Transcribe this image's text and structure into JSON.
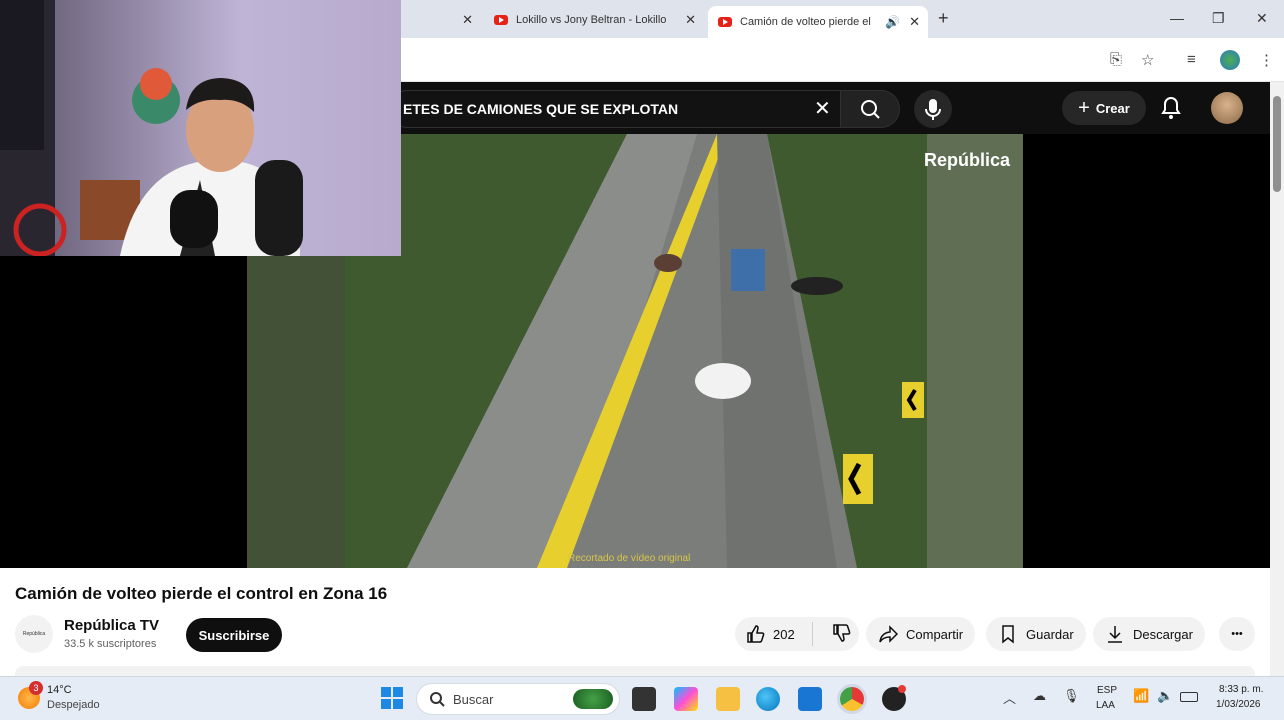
{
  "browser": {
    "tabs": [
      {
        "title": "",
        "active": false
      },
      {
        "title": "Lokillo vs Jony Beltran - Lokillo",
        "active": false
      },
      {
        "title": "Camión de volteo pierde el",
        "active": true
      }
    ],
    "new_tab_label": "+",
    "window": {
      "minimize": "—",
      "maximize": "❐",
      "close": "✕"
    }
  },
  "youtube": {
    "search_query": "ETES DE CAMIONES QUE SE EXPLOTAN",
    "create_label": "Crear",
    "video": {
      "watermark": "República",
      "crop_label": "Recortado de vídeo original",
      "title": "Camión de volteo pierde el control en Zona 16"
    },
    "channel": {
      "logo_text": "República",
      "name": "República TV",
      "subscribers": "33.5 k suscriptores",
      "subscribe_label": "Suscribirse"
    },
    "actions": {
      "likes": "202",
      "share_label": "Compartir",
      "save_label": "Guardar",
      "download_label": "Descargar",
      "more_label": "•••"
    }
  },
  "taskbar": {
    "weather": {
      "badge": "3",
      "temp": "14°C",
      "condition": "Despejado"
    },
    "search_label": "Buscar",
    "lang": {
      "line1": "ESP",
      "line2": "LAA"
    },
    "clock": {
      "time": "8:33 p. m.",
      "date": "1/03/2026"
    }
  }
}
